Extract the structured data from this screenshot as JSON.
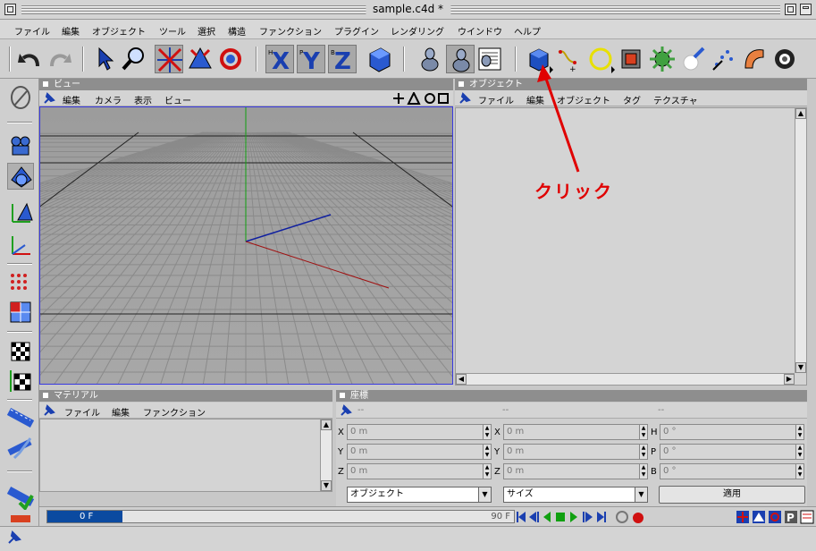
{
  "window": {
    "title": "sample.c4d *"
  },
  "menu": [
    "ファイル",
    "編集",
    "オブジェクト",
    "ツール",
    "選択",
    "構造",
    "ファンクション",
    "プラグイン",
    "レンダリング",
    "ウインドウ",
    "ヘルプ"
  ],
  "toolbar": {
    "icons": [
      "undo-icon",
      "redo-icon",
      "select-icon",
      "zoom-icon",
      "move-icon",
      "scale-icon",
      "rotate-icon",
      "x-axis-icon",
      "y-axis-icon",
      "z-axis-icon",
      "coordinate-system-icon",
      "render-view-icon",
      "render-picture-viewer-icon",
      "render-settings-icon",
      "cube-primitive-icon",
      "spline-icon",
      "circle-icon",
      "nurbs-icon",
      "modeling-icon",
      "light-icon",
      "particle-icon",
      "deformer-icon",
      "scene-icon"
    ],
    "axis_letters": [
      "X",
      "Y",
      "Z"
    ]
  },
  "viewport": {
    "title": "ビュー",
    "menu": [
      "編集",
      "カメラ",
      "表示",
      "ビュー"
    ]
  },
  "objects": {
    "title": "オブジェクト",
    "menu": [
      "ファイル",
      "編集",
      "オブジェクト",
      "タグ",
      "テクスチャ"
    ]
  },
  "materials": {
    "title": "マテリアル",
    "menu": [
      "ファイル",
      "編集",
      "ファンクション"
    ]
  },
  "coordinates": {
    "title": "座標",
    "col_headers": [
      "--",
      "--",
      "--"
    ],
    "position": [
      {
        "axis": "X",
        "value": "0 m"
      },
      {
        "axis": "Y",
        "value": "0 m"
      },
      {
        "axis": "Z",
        "value": "0 m"
      }
    ],
    "size": [
      {
        "axis": "X",
        "value": "0 m"
      },
      {
        "axis": "Y",
        "value": "0 m"
      },
      {
        "axis": "Z",
        "value": "0 m"
      }
    ],
    "rotation": [
      {
        "axis": "H",
        "value": "0 °"
      },
      {
        "axis": "P",
        "value": "0 °"
      },
      {
        "axis": "B",
        "value": "0 °"
      }
    ],
    "mode_select": "オブジェクト",
    "size_select": "サイズ",
    "apply_label": "適用"
  },
  "timeline": {
    "current": "0 F",
    "end": "90 F"
  },
  "annotation": {
    "text": "クリック",
    "color": "#e00000"
  },
  "colors": {
    "accent": "#3a3ae0",
    "timeline_fill": "#0b4aa0",
    "annotation": "#e00000"
  }
}
